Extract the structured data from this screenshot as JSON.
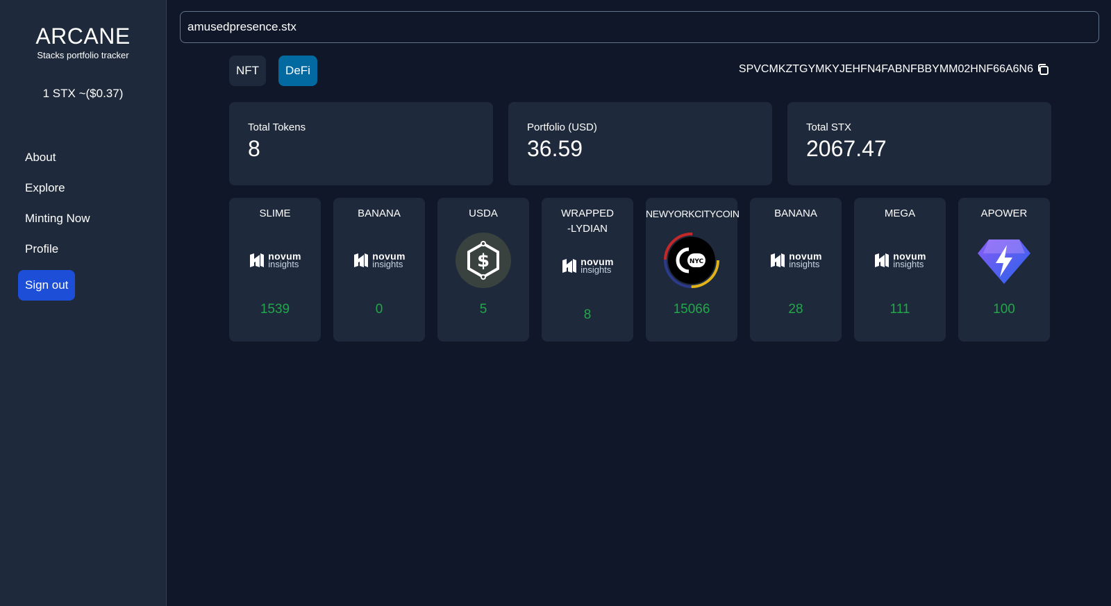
{
  "brand": {
    "title": "ARCANE",
    "subtitle": "Stacks portfolio tracker"
  },
  "price": "1 STX ~($0.37)",
  "nav": {
    "items": [
      "About",
      "Explore",
      "Minting Now",
      "Profile"
    ],
    "signout": "Sign out"
  },
  "search": {
    "value": "amusedpresence.stx"
  },
  "tabs": [
    "NFT",
    "DeFi"
  ],
  "address": "SPVCMKZTGYMKYJEHFN4FABNFBBYMM02HNF66A6N6",
  "stats": [
    {
      "label": "Total Tokens",
      "value": "8"
    },
    {
      "label": "Portfolio (USD)",
      "value": "36.59"
    },
    {
      "label": "Total STX",
      "value": "2067.47"
    }
  ],
  "tokens": [
    {
      "name": "SLIME",
      "amount": "1539",
      "logo": "novum-insights-logo"
    },
    {
      "name": "BANANA",
      "amount": "0",
      "logo": "novum-insights-logo"
    },
    {
      "name": "USDA",
      "amount": "5",
      "logo": "usda-dollar-hexagon-logo"
    },
    {
      "name": "WRAPPED-LYDIAN",
      "amount": "8",
      "logo": "novum-insights-logo"
    },
    {
      "name": "NEWYORKCITYCOIN",
      "amount": "15066",
      "logo": "nyc-coin-logo"
    },
    {
      "name": "BANANA",
      "amount": "28",
      "logo": "novum-insights-logo"
    },
    {
      "name": "MEGA",
      "amount": "111",
      "logo": "novum-insights-logo"
    },
    {
      "name": "APOWER",
      "amount": "100",
      "logo": "diamond-bolt-logo"
    }
  ],
  "novum": {
    "word1": "novum",
    "word2": "insights"
  },
  "colors": {
    "accent_blue": "#1d4ed8",
    "tab_active": "#0369a1",
    "amount_green": "#22a84a",
    "bg": "#0f1729",
    "panel": "#1e293b"
  }
}
